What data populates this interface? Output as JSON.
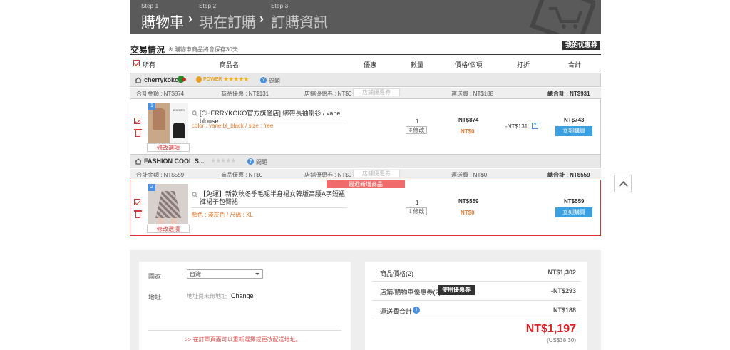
{
  "steps": [
    {
      "num": "Step 1",
      "name": "購物車",
      "active": true
    },
    {
      "num": "Step 2",
      "name": "現在訂購",
      "active": false
    },
    {
      "num": "Step 3",
      "name": "訂購資訊",
      "active": false
    }
  ],
  "section": {
    "title": "交易情況",
    "note": "※ 購物車商品將會保存30天",
    "my_coupon": "我的优惠券"
  },
  "table_headers": {
    "select_all": "所有",
    "product": "商品名",
    "discount": "優惠",
    "qty": "數量",
    "price": "價格/個項",
    "off": "打折",
    "total": "合計"
  },
  "shops": [
    {
      "name": "cherrykoko_",
      "grade": "POWER",
      "rating_stars": 5,
      "question": "問題",
      "summary": {
        "amount": "合計金額 : NT$874",
        "product_discount": "商品優惠 : NT$131",
        "store_coupon": "店鋪優惠券 : NT$0",
        "coupon_btn": "店鋪優惠券",
        "shipping": "運送費 : NT$188",
        "grand": "總合計 : NT$931"
      },
      "item": {
        "index": "1",
        "name": "[CHERRYKOKO官方旗艦店] 綁帶長袖喇衫 / vane blouse",
        "option": "color : vane bl_black / size : free",
        "qty": "1",
        "qty_btn": "修改",
        "price": "NT$874",
        "ship": "NT$0",
        "discount": "-NT$131",
        "discount_q": "?",
        "total": "NT$743",
        "buy": "立刻購買",
        "edit": "修改選項"
      }
    },
    {
      "name": "FASHION COOL S...",
      "rating_stars": 0,
      "question": "問題",
      "summary": {
        "amount": "合計金額 : NT$559",
        "product_discount": "商品優惠 : NT$0",
        "store_coupon": "店鋪優惠券 : NT$0",
        "coupon_btn": "店鋪優惠券",
        "shipping": "運送費 : NT$0",
        "grand": "總合計 : NT$559"
      },
      "item": {
        "index": "2",
        "tag": "最近新增商品",
        "name": "【免運】新款秋冬季毛呢半身裙女韓版高腰A字短裙褲裙子包臀裙",
        "option": "顏色 : 淺灰色 / 尺碼 : XL",
        "qty": "1",
        "qty_btn": "修改",
        "price": "NT$559",
        "ship": "NT$0",
        "total": "NT$559",
        "buy": "立刻購買",
        "edit": "修改選項"
      }
    }
  ],
  "address": {
    "country_label": "國家",
    "country_value": "台灣",
    "addr_label": "地址",
    "addr_placeholder": "地址尚未無地址",
    "change": "Change",
    "note": ">> 在訂單頁面可以重新選擇或更改配送地址。"
  },
  "totals": {
    "items_label": "商品價格(2)",
    "items_value": "NT$1,302",
    "coupon_label": "店鋪/購物車優惠券(2)",
    "coupon_btn": "使用優惠券",
    "coupon_value": "-NT$293",
    "ship_label": "運送費合計",
    "ship_value": "NT$188",
    "grand": "NT$1,197",
    "usd": "(US$38.30)"
  }
}
